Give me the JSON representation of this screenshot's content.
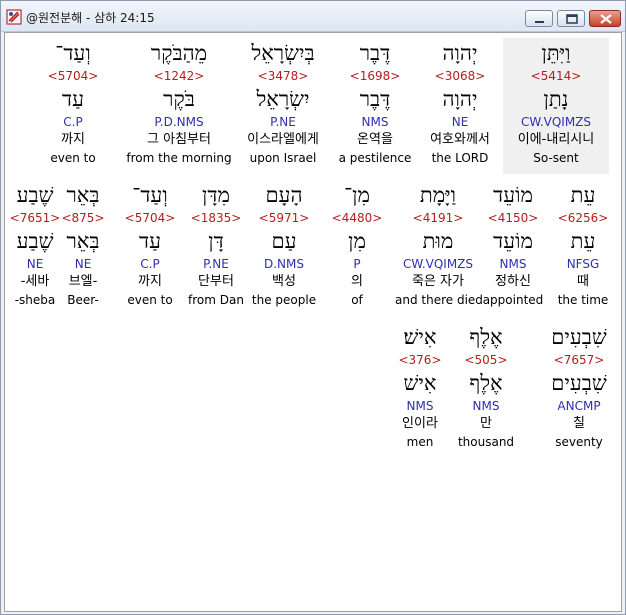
{
  "window": {
    "title": "@원전분해 - 삼하 24:15"
  },
  "rows": [
    [
      {
        "heb": "וַיִּתֵּן",
        "strong": "<5414>",
        "lemma": "נָתַן",
        "morph": "CW.VQIMZS",
        "kor": "이에-내리시니",
        "eng": "So-sent",
        "highlight": true
      },
      {
        "heb": "יְהוָה",
        "strong": "<3068>",
        "lemma": "יְהוָה",
        "morph": "NE",
        "kor": "여호와께서",
        "eng": "the LORD"
      },
      {
        "heb": "דֶּבֶר",
        "strong": "<1698>",
        "lemma": "דֶּבֶר",
        "morph": "NMS",
        "kor": "온역을",
        "eng": "a pestilence"
      },
      {
        "heb": "בְּיִשְׂרָאֵל",
        "strong": "<3478>",
        "lemma": "יִשְׂרָאֵל",
        "morph": "P.NE",
        "kor": "이스라엘에게",
        "eng": "upon Israel"
      },
      {
        "heb": "מֵהַבֹּקֶר",
        "strong": "<1242>",
        "lemma": "בֹּקֶר",
        "morph": "P.D.NMS",
        "kor": "그 아침부터",
        "eng": "from the morning"
      },
      {
        "heb": "וְעַד־",
        "strong": "<5704>",
        "lemma": "עַד",
        "morph": "C.P",
        "kor": "까지",
        "eng": "even to"
      }
    ],
    [
      {
        "heb": "עֵת",
        "strong": "<6256>",
        "lemma": "עֵת",
        "morph": "NFSG",
        "kor": "때",
        "eng": "the time"
      },
      {
        "heb": "מוֹעֵד",
        "strong": "<4150>",
        "lemma": "מוֹעֵד",
        "morph": "NMS",
        "kor": "정하신",
        "eng": "appointed"
      },
      {
        "heb": "וַיָּמָת",
        "strong": "<4191>",
        "lemma": "מוּת",
        "morph": "CW.VQIMZS",
        "kor": "죽은 자가",
        "eng": "and there died"
      },
      {
        "heb": "מִן־",
        "strong": "<4480>",
        "lemma": "מִן",
        "morph": "P",
        "kor": "의",
        "eng": "of"
      },
      {
        "heb": "הָעָם",
        "strong": "<5971>",
        "lemma": "עַם",
        "morph": "D.NMS",
        "kor": "백성",
        "eng": "the people"
      },
      {
        "heb": "מִדָּן",
        "strong": "<1835>",
        "lemma": "דָּן",
        "morph": "P.NE",
        "kor": "단부터",
        "eng": "from Dan"
      },
      {
        "heb": "וְעַד־",
        "strong": "<5704>",
        "lemma": "עַד",
        "morph": "C.P",
        "kor": "까지",
        "eng": "even to"
      },
      {
        "heb": "בְּאֵר",
        "strong": "<875>",
        "lemma": "בְּאֵר",
        "morph": "NE",
        "kor": "브엘-",
        "eng": "Beer-"
      },
      {
        "heb": "שֶׁבַע",
        "strong": "<7651>",
        "lemma": "שֶׁבַע",
        "morph": "NE",
        "kor": "-세바",
        "eng": "-sheba"
      }
    ],
    [
      {
        "heb": "שִׁבְעִים",
        "strong": "<7657>",
        "lemma": "שִׁבְעִים",
        "morph": "ANCMP",
        "kor": "칠",
        "eng": "seventy"
      },
      {
        "heb": "אֶלֶף",
        "strong": "<505>",
        "lemma": "אֶלֶף",
        "morph": "NMS",
        "kor": "만",
        "eng": "thousand"
      },
      {
        "heb": "אִישׁ׃",
        "strong": "<376>",
        "lemma": "אִישׁ",
        "morph": "NMS",
        "kor": "인이라",
        "eng": "men"
      }
    ]
  ]
}
